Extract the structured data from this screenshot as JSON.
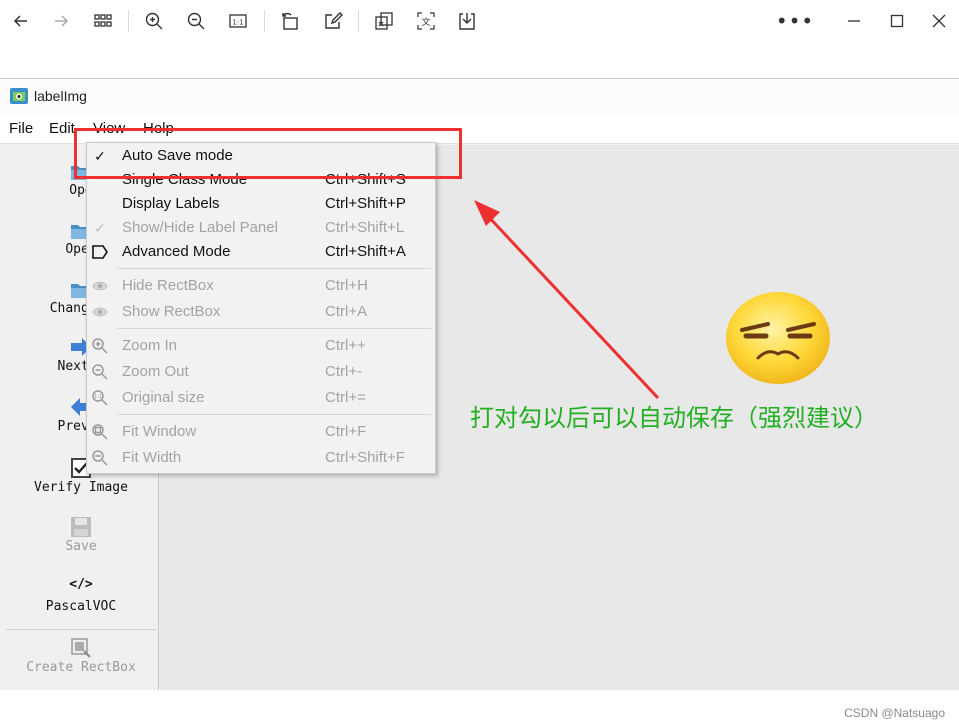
{
  "viewer_toolbar": {
    "icons": [
      "back-icon",
      "forward-icon",
      "thumbnails-icon",
      "zoom-in-icon",
      "zoom-out-icon",
      "actual-size-icon",
      "rotate-icon",
      "edit-icon",
      "extract-text-icon",
      "translate-icon",
      "save-icon",
      "more-icon",
      "minimize-icon",
      "maximize-icon",
      "close-icon"
    ],
    "more_label": "•••"
  },
  "app": {
    "title": "labelImg",
    "menus": [
      "File",
      "Edit",
      "View",
      "Help"
    ]
  },
  "toolbar": {
    "items": [
      {
        "label": "Ope",
        "icon": "folder-icon",
        "enabled": true
      },
      {
        "label": "Open ",
        "icon": "folder-icon",
        "enabled": true
      },
      {
        "label": "Change S",
        "icon": "folder-icon",
        "enabled": true
      },
      {
        "label": "Next I",
        "icon": "next-arrow-icon",
        "enabled": true
      },
      {
        "label": "Prev I",
        "icon": "prev-arrow-icon",
        "enabled": true
      },
      {
        "label": "Verify Image",
        "icon": "checkbox-icon",
        "enabled": true
      },
      {
        "label": "Save",
        "icon": "floppy-icon",
        "enabled": false
      },
      {
        "label": "PascalVOC",
        "icon": "code-icon",
        "enabled": true,
        "glyph": "</>"
      },
      {
        "label": "Create RectBox",
        "icon": "rectbox-icon",
        "enabled": false
      }
    ]
  },
  "view_menu": {
    "items": [
      {
        "label": "Auto Save mode",
        "shortcut": "",
        "enabled": true,
        "icon": "checkmark-icon",
        "glyph": "✓"
      },
      {
        "label": "Single Class Mode",
        "shortcut": "Ctrl+Shift+S",
        "enabled": true,
        "icon": ""
      },
      {
        "label": "Display Labels",
        "shortcut": "Ctrl+Shift+P",
        "enabled": true,
        "icon": ""
      },
      {
        "label": "Show/Hide Label Panel",
        "shortcut": "Ctrl+Shift+L",
        "enabled": false,
        "icon": "checkmark-icon",
        "glyph": "✓"
      },
      {
        "label": "Advanced Mode",
        "shortcut": "Ctrl+Shift+A",
        "enabled": true,
        "icon": "tag-icon"
      },
      {
        "label": "Hide RectBox",
        "shortcut": "Ctrl+H",
        "enabled": false,
        "icon": "eye-icon"
      },
      {
        "label": "Show RectBox",
        "shortcut": "Ctrl+A",
        "enabled": false,
        "icon": "eye-icon"
      },
      {
        "label": "Zoom In",
        "shortcut": "Ctrl++",
        "enabled": false,
        "icon": "zoom-in-icon"
      },
      {
        "label": "Zoom Out",
        "shortcut": "Ctrl+-",
        "enabled": false,
        "icon": "zoom-out-icon"
      },
      {
        "label": "Original size",
        "shortcut": "Ctrl+=",
        "enabled": false,
        "icon": "zoom-original-icon"
      },
      {
        "label": "Fit Window",
        "shortcut": "Ctrl+F",
        "enabled": false,
        "icon": "fit-window-icon"
      },
      {
        "label": "Fit Width",
        "shortcut": "Ctrl+Shift+F",
        "enabled": false,
        "icon": "fit-width-icon"
      }
    ]
  },
  "annotation": {
    "note": "打对勾以后可以自动保存（强烈建议）",
    "highlight_color": "#ee3030",
    "note_color": "#22b022"
  },
  "watermark": "CSDN @Natsuago"
}
